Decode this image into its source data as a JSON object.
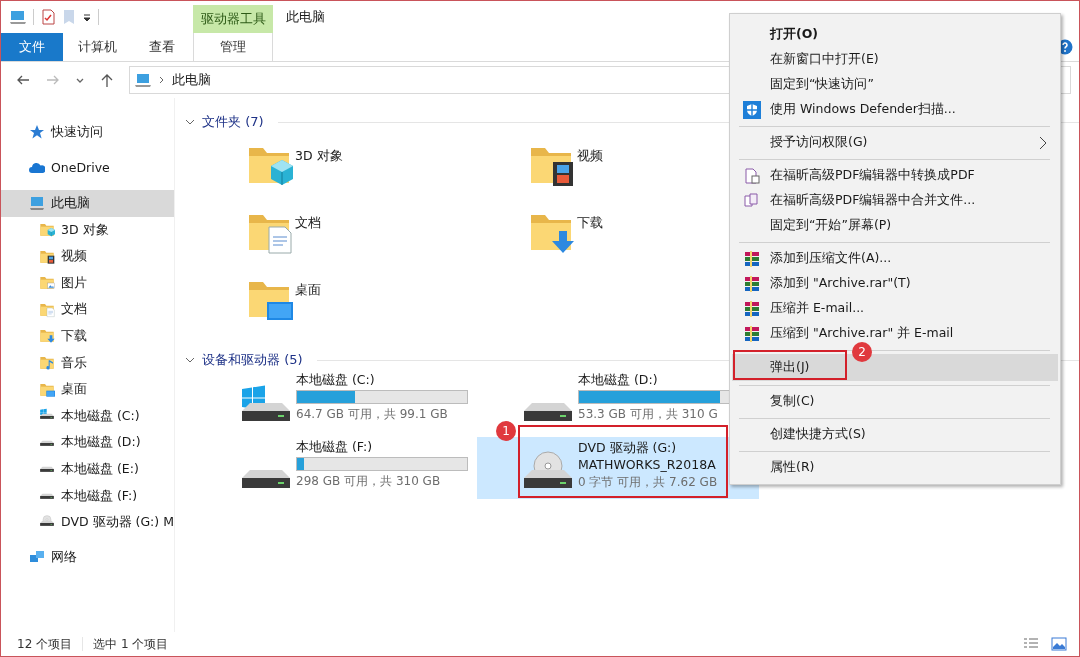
{
  "window": {
    "title": "此电脑"
  },
  "ribbon": {
    "contextual_group": "驱动器工具",
    "tabs": [
      {
        "label": "文件",
        "kind": "file"
      },
      {
        "label": "计算机",
        "kind": "tab"
      },
      {
        "label": "查看",
        "kind": "tab"
      },
      {
        "label": "管理",
        "kind": "contextual"
      }
    ]
  },
  "address_bar": {
    "path": "此电脑"
  },
  "sidebar": {
    "items": [
      {
        "label": "快速访问",
        "kind": "star",
        "selected": false
      },
      {
        "label": "OneDrive",
        "kind": "cloud",
        "selected": false
      },
      {
        "label": "此电脑",
        "kind": "pc",
        "selected": true,
        "children": [
          {
            "label": "3D 对象",
            "kind": "folder-3d",
            "selected": false
          },
          {
            "label": "视频",
            "kind": "folder-video",
            "selected": false
          },
          {
            "label": "图片",
            "kind": "folder-pictures",
            "selected": false
          },
          {
            "label": "文档",
            "kind": "folder-docs",
            "selected": false
          },
          {
            "label": "下载",
            "kind": "folder-downloads",
            "selected": false
          },
          {
            "label": "音乐",
            "kind": "folder-music",
            "selected": false
          },
          {
            "label": "桌面",
            "kind": "folder-desktop",
            "selected": false
          },
          {
            "label": "本地磁盘 (C:)",
            "kind": "drive-windows",
            "selected": false
          },
          {
            "label": "本地磁盘 (D:)",
            "kind": "drive",
            "selected": false
          },
          {
            "label": "本地磁盘 (E:)",
            "kind": "drive",
            "selected": false
          },
          {
            "label": "本地磁盘 (F:)",
            "kind": "drive",
            "selected": false
          },
          {
            "label": "DVD 驱动器 (G:) M",
            "kind": "dvd",
            "selected": false
          }
        ]
      },
      {
        "label": "网络",
        "kind": "network",
        "selected": false
      }
    ]
  },
  "sections": [
    {
      "title": "文件夹 (7)",
      "expanded": true,
      "kind": "folders",
      "items": [
        {
          "name": "3D 对象",
          "kind": "folder-3d"
        },
        {
          "name": "视频",
          "kind": "folder-video"
        },
        {
          "name": "文档",
          "kind": "folder-docs"
        },
        {
          "name": "下载",
          "kind": "folder-downloads"
        },
        {
          "name": "桌面",
          "kind": "folder-desktop"
        }
      ]
    },
    {
      "title": "设备和驱动器 (5)",
      "expanded": true,
      "kind": "drives",
      "items": [
        {
          "name": "本地磁盘 (C:)",
          "kind": "drive-windows",
          "level": 0.34,
          "reading": "64.7 GB 可用，共 99.1 GB",
          "selected": false
        },
        {
          "name": "本地磁盘 (D:)",
          "kind": "drive",
          "level": 0.83,
          "reading": "53.3 GB 可用，共 310 G",
          "selected": false
        },
        {
          "name": "本地磁盘 (F:)",
          "kind": "drive",
          "level": 0.04,
          "reading": "298 GB 可用，共 310 GB",
          "selected": false
        },
        {
          "name": "DVD 驱动器 (G:)",
          "volume_label": "MATHWORKS_R2018A",
          "kind": "dvd",
          "reading": "0 字节 可用，共 7.62 GB",
          "selected": true
        }
      ]
    }
  ],
  "context_menu": {
    "items": [
      {
        "kind": "item",
        "label": "打开(O)",
        "bold": true
      },
      {
        "kind": "item",
        "label": "在新窗口中打开(E)"
      },
      {
        "kind": "item",
        "label": "固定到“快速访问”"
      },
      {
        "kind": "shield",
        "label": "使用 Windows Defender扫描..."
      },
      {
        "kind": "separator"
      },
      {
        "kind": "item",
        "label": "授予访问权限(G)",
        "submenu": true
      },
      {
        "kind": "separator"
      },
      {
        "kind": "pdf",
        "label": "在福昕高级PDF编辑器中转换成PDF"
      },
      {
        "kind": "merge",
        "label": "在福昕高级PDF编辑器中合并文件..."
      },
      {
        "kind": "item",
        "label": "固定到“开始”屏幕(P)"
      },
      {
        "kind": "separator"
      },
      {
        "kind": "archive",
        "label": "添加到压缩文件(A)..."
      },
      {
        "kind": "archive",
        "label": "添加到 \"Archive.rar\"(T)"
      },
      {
        "kind": "archive",
        "label": "压缩并 E-mail..."
      },
      {
        "kind": "archive",
        "label": "压缩到 \"Archive.rar\" 并 E-mail"
      },
      {
        "kind": "separator"
      },
      {
        "kind": "item",
        "label": "弹出(J)",
        "highlighted": true
      },
      {
        "kind": "separator"
      },
      {
        "kind": "item",
        "label": "复制(C)"
      },
      {
        "kind": "separator"
      },
      {
        "kind": "item",
        "label": "创建快捷方式(S)"
      },
      {
        "kind": "separator"
      },
      {
        "kind": "item",
        "label": "属性(R)"
      }
    ]
  },
  "annotations": [
    {
      "number": "1"
    },
    {
      "number": "2"
    }
  ],
  "status_bar": {
    "item_count": "12 个项目",
    "selection": "选中 1 个项目"
  }
}
